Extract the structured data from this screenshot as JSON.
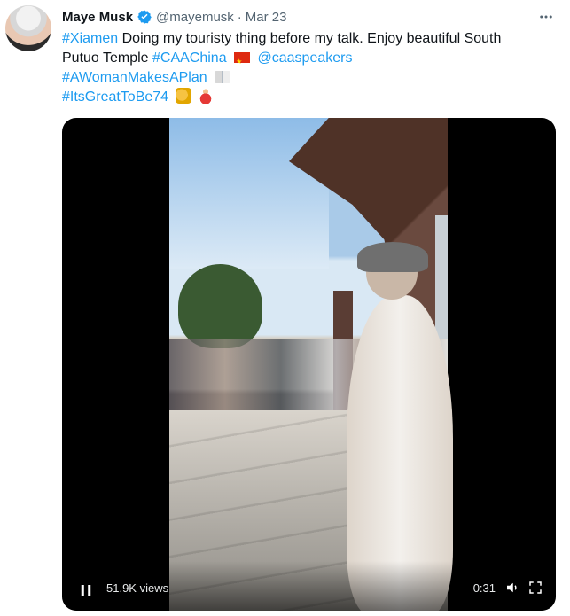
{
  "tweet": {
    "author": {
      "name": "Maye Musk",
      "handle": "@mayemusk",
      "date": "Mar 23",
      "verified": true
    },
    "text": {
      "line1": "Doing my touristy thing before my talk. Enjoy beautiful South",
      "line2_prefix": "Putuo Temple",
      "hashtags": [
        "#Xiamen",
        "#CAAChina",
        "#AWomanMakesAPlan",
        "#ItsGreatToBe74"
      ],
      "mention": "@caaspeakers"
    },
    "media": {
      "views": "51.9K views",
      "duration": "0:31"
    },
    "colors": {
      "link": "#1d9bf0",
      "text": "#0f1419",
      "secondary": "#536471"
    },
    "icons": {
      "verified": "verified-badge-icon",
      "more": "more-horizontal-icon",
      "flag": "china-flag-icon",
      "book": "open-book-icon",
      "muscle": "flexed-biceps-icon",
      "dancer": "woman-dancing-icon",
      "play": "pause-icon",
      "mute": "volume-icon",
      "fullscreen": "fullscreen-icon"
    }
  }
}
